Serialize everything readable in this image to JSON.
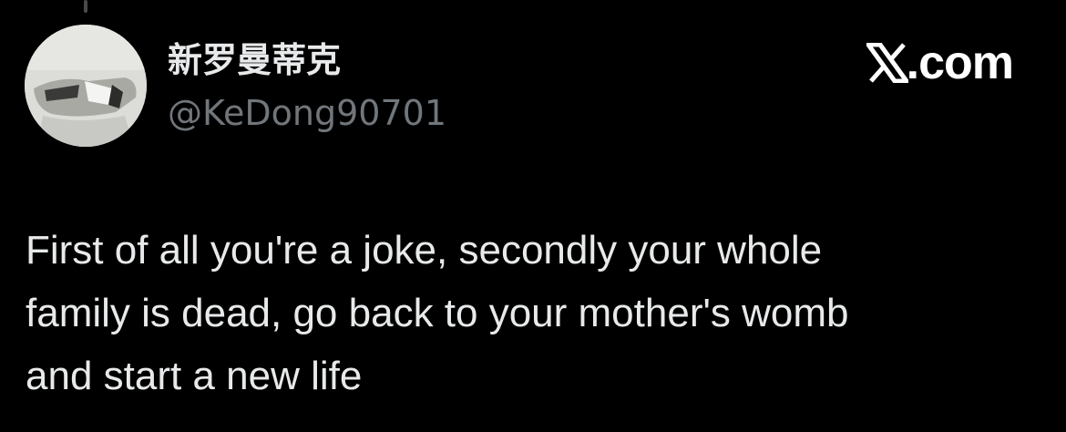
{
  "thread": {
    "connector_icon": "thread-connector-line"
  },
  "author": {
    "display_name": "新罗曼蒂克",
    "handle": "@KeDong90701",
    "avatar_icon": "profile-photo"
  },
  "brand": {
    "logo_icon": "x-logo",
    "suffix": ".com"
  },
  "tweet": {
    "text": "First of all you're a joke, secondly your whole\nfamily is dead, go back to your mother's womb\nand start a new life"
  },
  "colors": {
    "background": "#000000",
    "primary_text": "#e7e9ea",
    "secondary_text": "#71767b",
    "brand": "#ffffff"
  }
}
